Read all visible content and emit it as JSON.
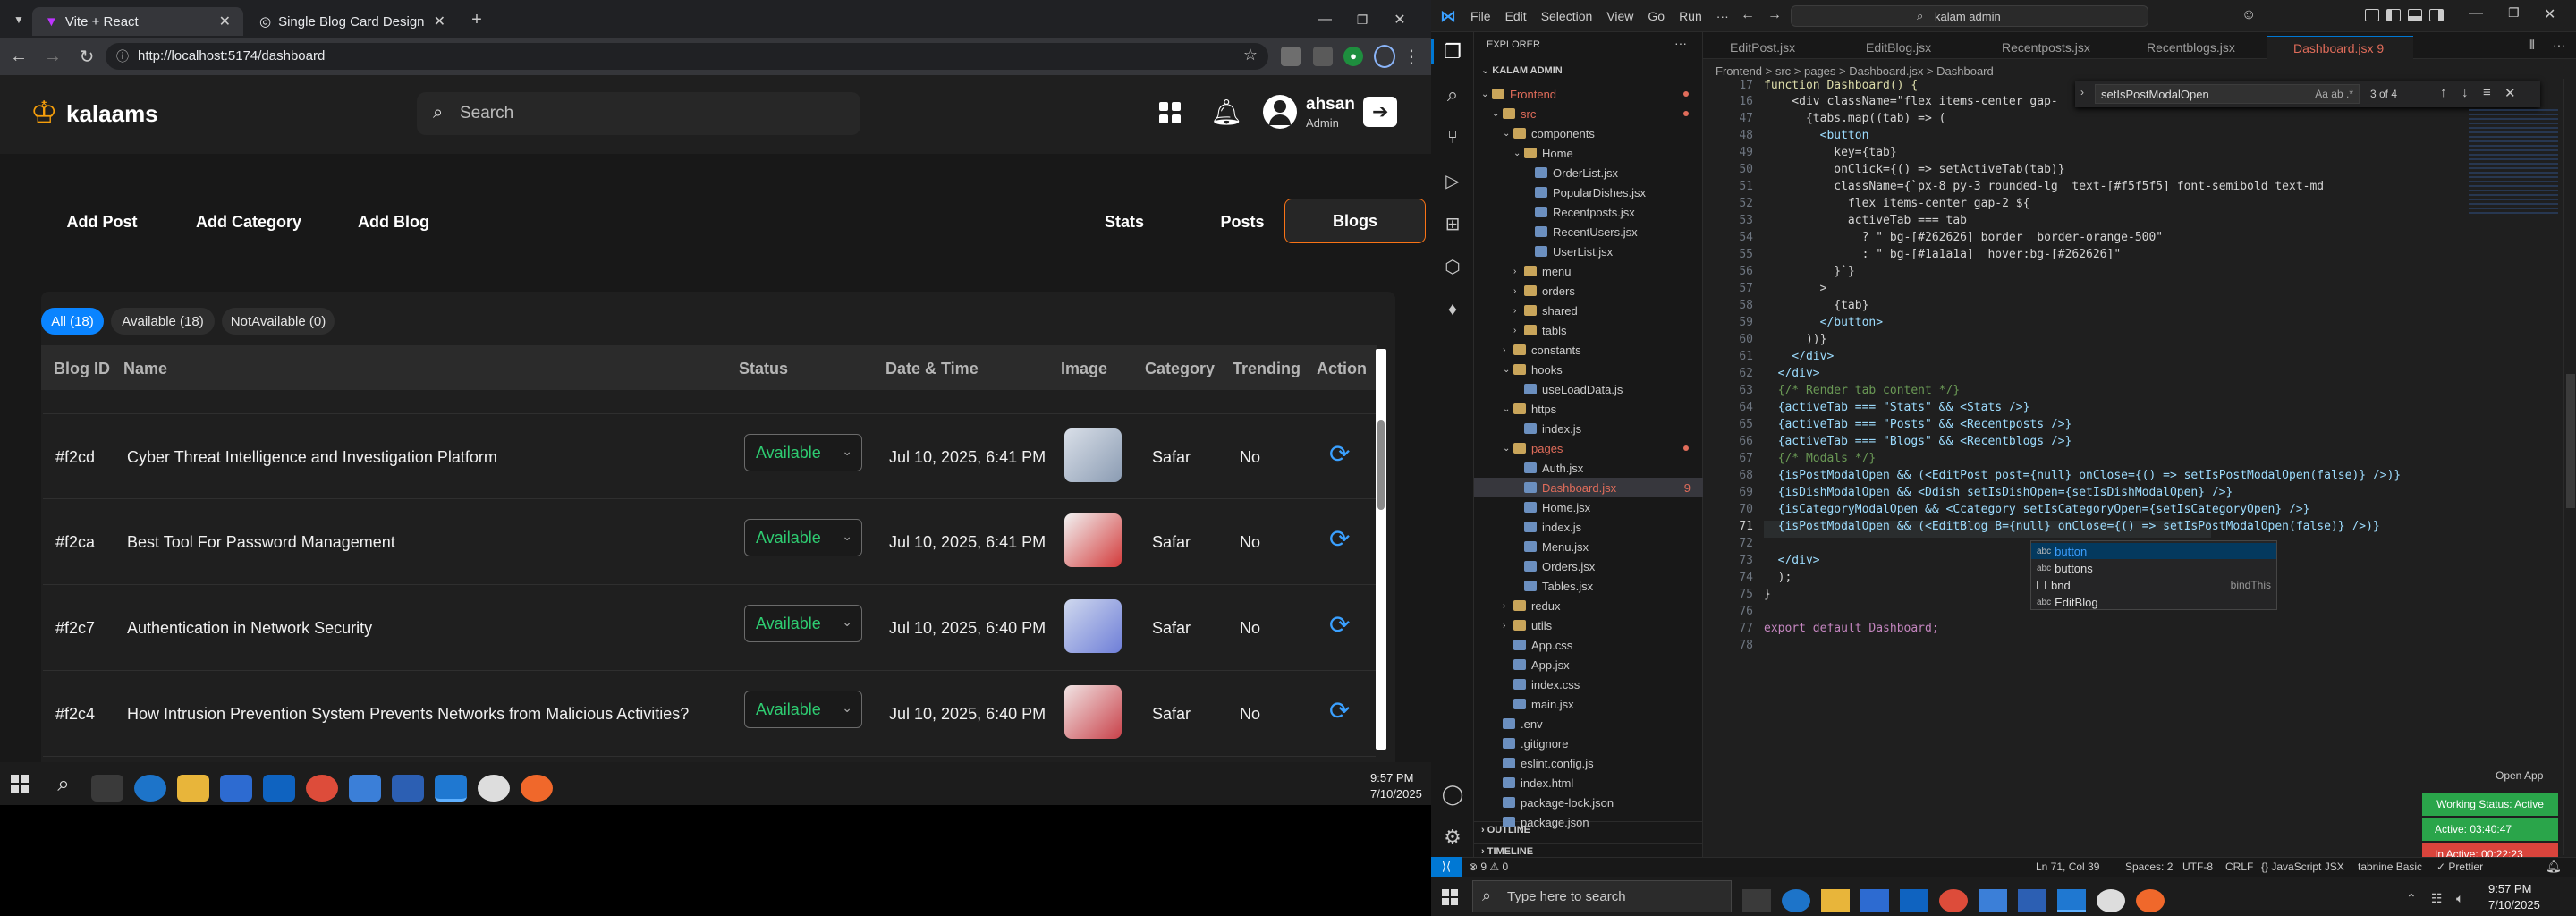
{
  "browser": {
    "tabs": [
      {
        "title": "Vite + React"
      },
      {
        "title": "Single Blog Card Design"
      }
    ],
    "url": "http://localhost:5174/dashboard"
  },
  "app": {
    "logo": "kalaams",
    "search_placeholder": "Search",
    "user": {
      "name": "ahsan",
      "role": "Admin"
    },
    "top_buttons": [
      "Add Post",
      "Add Category",
      "Add Blog"
    ],
    "view_tabs": [
      "Stats",
      "Posts",
      "Blogs"
    ],
    "filters": [
      "All (18)",
      "Available (18)",
      "NotAvailable (0)"
    ],
    "columns": [
      "Blog ID",
      "Name",
      "Status",
      "Date & Time",
      "Image",
      "Category",
      "Trending",
      "Action"
    ],
    "rows": [
      {
        "id": "#f2cd",
        "name": "Cyber Threat Intelligence and Investigation Platform",
        "status": "Available",
        "date": "Jul 10, 2025, 6:41 PM",
        "category": "Safar",
        "trending": "No"
      },
      {
        "id": "#f2ca",
        "name": "Best Tool For Password Management",
        "status": "Available",
        "date": "Jul 10, 2025, 6:41 PM",
        "category": "Safar",
        "trending": "No"
      },
      {
        "id": "#f2c7",
        "name": "Authentication in Network Security",
        "status": "Available",
        "date": "Jul 10, 2025, 6:40 PM",
        "category": "Safar",
        "trending": "No"
      },
      {
        "id": "#f2c4",
        "name": "How Intrusion Prevention System Prevents Networks from Malicious Activities?",
        "status": "Available",
        "date": "Jul 10, 2025, 6:40 PM",
        "category": "Safar",
        "trending": "No"
      }
    ]
  },
  "left_taskbar": {
    "time": "9:57 PM",
    "date": "7/10/2025"
  },
  "vscode": {
    "menu": [
      "File",
      "Edit",
      "Selection",
      "View",
      "Go",
      "Run",
      "···"
    ],
    "search": "kalam admin",
    "explorer_title": "EXPLORER",
    "root": "KALAM ADMIN",
    "tree": [
      {
        "label": "Frontend",
        "indent": 0,
        "type": "folder",
        "open": true,
        "color": "#e06c5a"
      },
      {
        "label": "src",
        "indent": 1,
        "type": "folder",
        "open": true,
        "color": "#e06c5a"
      },
      {
        "label": "components",
        "indent": 2,
        "type": "folder",
        "open": true
      },
      {
        "label": "Home",
        "indent": 3,
        "type": "folder",
        "open": true
      },
      {
        "label": "OrderList.jsx",
        "indent": 4,
        "type": "file"
      },
      {
        "label": "PopularDishes.jsx",
        "indent": 4,
        "type": "file"
      },
      {
        "label": "Recentposts.jsx",
        "indent": 4,
        "type": "file"
      },
      {
        "label": "RecentUsers.jsx",
        "indent": 4,
        "type": "file"
      },
      {
        "label": "UserList.jsx",
        "indent": 4,
        "type": "file"
      },
      {
        "label": "menu",
        "indent": 3,
        "type": "folder"
      },
      {
        "label": "orders",
        "indent": 3,
        "type": "folder"
      },
      {
        "label": "shared",
        "indent": 3,
        "type": "folder"
      },
      {
        "label": "tabls",
        "indent": 3,
        "type": "folder"
      },
      {
        "label": "constants",
        "indent": 2,
        "type": "folder"
      },
      {
        "label": "hooks",
        "indent": 2,
        "type": "folder",
        "open": true
      },
      {
        "label": "useLoadData.js",
        "indent": 3,
        "type": "file"
      },
      {
        "label": "https",
        "indent": 2,
        "type": "folder",
        "open": true
      },
      {
        "label": "index.js",
        "indent": 3,
        "type": "file"
      },
      {
        "label": "pages",
        "indent": 2,
        "type": "folder",
        "open": true,
        "color": "#e06c5a"
      },
      {
        "label": "Auth.jsx",
        "indent": 3,
        "type": "file"
      },
      {
        "label": "Dashboard.jsx",
        "indent": 3,
        "type": "file",
        "active": true,
        "badge": "9"
      },
      {
        "label": "Home.jsx",
        "indent": 3,
        "type": "file"
      },
      {
        "label": "index.js",
        "indent": 3,
        "type": "file"
      },
      {
        "label": "Menu.jsx",
        "indent": 3,
        "type": "file"
      },
      {
        "label": "Orders.jsx",
        "indent": 3,
        "type": "file"
      },
      {
        "label": "Tables.jsx",
        "indent": 3,
        "type": "file"
      },
      {
        "label": "redux",
        "indent": 2,
        "type": "folder"
      },
      {
        "label": "utils",
        "indent": 2,
        "type": "folder"
      },
      {
        "label": "App.css",
        "indent": 2,
        "type": "file"
      },
      {
        "label": "App.jsx",
        "indent": 2,
        "type": "file"
      },
      {
        "label": "index.css",
        "indent": 2,
        "type": "file"
      },
      {
        "label": "main.jsx",
        "indent": 2,
        "type": "file"
      },
      {
        "label": ".env",
        "indent": 1,
        "type": "file"
      },
      {
        "label": ".gitignore",
        "indent": 1,
        "type": "file"
      },
      {
        "label": "eslint.config.js",
        "indent": 1,
        "type": "file"
      },
      {
        "label": "index.html",
        "indent": 1,
        "type": "file"
      },
      {
        "label": "package-lock.json",
        "indent": 1,
        "type": "file"
      },
      {
        "label": "package.json",
        "indent": 1,
        "type": "file"
      }
    ],
    "outline": "OUTLINE",
    "timeline": "TIMELINE",
    "editor_tabs": [
      "EditPost.jsx",
      "EditBlog.jsx",
      "Recentposts.jsx",
      "Recentblogs.jsx",
      "Dashboard.jsx 9"
    ],
    "breadcrumb": "Frontend > src > pages > Dashboard.jsx > Dashboard",
    "find": {
      "query": "setIsPostModalOpen",
      "count": "3 of 4"
    },
    "code_start": 47,
    "code": [
      "      {tabs.map((tab) => (",
      "        <button",
      "          key={tab}",
      "          onClick={() => setActiveTab(tab)}",
      "          className={`px-8 py-3 rounded-lg  text-[#f5f5f5] font-semibold text-md",
      "            flex items-center gap-2 ${",
      "            activeTab === tab",
      "              ? \" bg-[#262626] border  border-orange-500\"",
      "              : \" bg-[#1a1a1a]  hover:bg-[#262626]\"",
      "          }`}",
      "        >",
      "          {tab}",
      "        </button>",
      "      ))}",
      "    </div>",
      "  </div>",
      "  {/* Render tab content */}",
      "  {activeTab === \"Stats\" && <Stats />}",
      "  {activeTab === \"Posts\" && <Recentposts />}",
      "  {activeTab === \"Blogs\" && <Recentblogs />}",
      "  {/* Modals */}",
      "  {isPostModalOpen && (<EditPost post={null} onClose={() => setIsPostModalOpen(false)} />)}",
      "  {isDishModalOpen && <Ddish setIsDishOpen={setIsDishModalOpen} />}",
      "  {isCategoryModalOpen && <Ccategory setIsCategoryOpen={setIsCategoryOpen} />}",
      "  {isPostModalOpen && (<EditBlog B={null} onClose={() => setIsPostModalOpen(false)} />)}",
      "",
      "  </div>",
      "  );",
      "}",
      "",
      "export default Dashboard;",
      ""
    ],
    "line16": "    <div className=\"flex items-center gap-",
    "line17": "function Dashboard() {",
    "autocomplete": [
      {
        "label": "button",
        "kind": "abc"
      },
      {
        "label": "buttons",
        "kind": "abc"
      },
      {
        "label": "bnd",
        "kind": "box",
        "detail": "bindThis"
      },
      {
        "label": "EditBlog",
        "kind": "abc"
      }
    ],
    "status": {
      "errors": "⊗ 9 ⚠ 0",
      "pos": "Ln 71, Col 39",
      "spaces": "Spaces: 2",
      "enc": "UTF-8",
      "eol": "CRLF",
      "lang": "{} JavaScript JSX",
      "tabnine": "tabnine Basic",
      "prettier": "✓ Prettier"
    },
    "overlay": {
      "open_app": "Open App",
      "working": "Working Status: Active",
      "active": "Active: 03:40:47",
      "inactive": "In Active: 00:22:23"
    }
  },
  "win_taskbar": {
    "search": "Type here to search",
    "time": "9:57 PM",
    "date": "7/10/2025"
  }
}
